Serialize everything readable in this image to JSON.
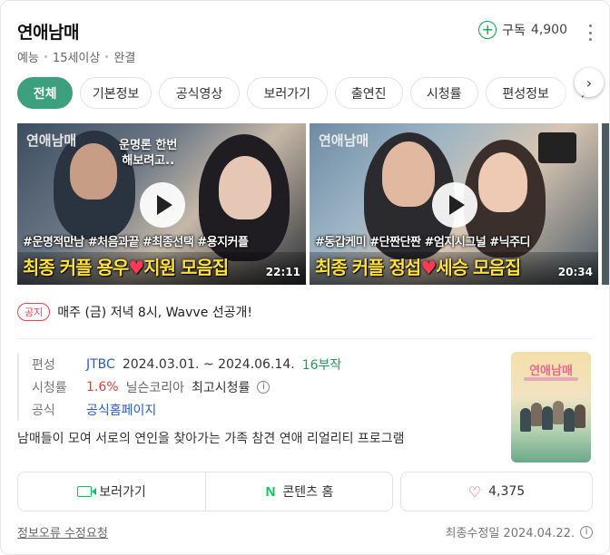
{
  "header": {
    "title": "연애남매",
    "meta": [
      "예능",
      "15세이상",
      "완결"
    ],
    "subscribe_label": "구독",
    "subscribe_count": "4,900",
    "subscribe_icon": "plus-icon",
    "more_icon": "kebab-icon"
  },
  "tabs": [
    {
      "label": "전체",
      "active": true
    },
    {
      "label": "기본정보",
      "active": false
    },
    {
      "label": "공식영상",
      "active": false
    },
    {
      "label": "보러가기",
      "active": false
    },
    {
      "label": "출연진",
      "active": false
    },
    {
      "label": "시청률",
      "active": false
    },
    {
      "label": "편성정보",
      "active": false
    }
  ],
  "clips": [
    {
      "logo": "연애남매",
      "bubble": "운명론 한번\n해보려고..",
      "hashtags": "#운명적만남 #처음과끝 #최종선택 #용지커플",
      "caption_a": "최종 커플 용우",
      "caption_b": "지원 모음집",
      "duration": "22:11"
    },
    {
      "logo": "연애남매",
      "bubble": "",
      "hashtags": "#동갑케미 #단짠단짠 #엄지시그널 #닉주디",
      "caption_a": "최종 커플 정섭",
      "caption_b": "세승 모음집",
      "duration": "20:34"
    }
  ],
  "notice": {
    "badge": "공지",
    "text": "매주 (금) 저녁 8시, Wavve 선공개!"
  },
  "info": {
    "schedule_key": "편성",
    "channel": "JTBC",
    "period": "2024.03.01. ~ 2024.06.14.",
    "episodes": "16부작",
    "rating_key": "시청률",
    "rating_value": "1.6%",
    "rating_source": "닐슨코리아",
    "rating_note": "최고시청률",
    "official_key": "공식",
    "official_link": "공식홈페이지",
    "description": "남매들이 모여 서로의 연인을 찾아가는 가족 참견 연애 리얼리티 프로그램"
  },
  "poster": {
    "title": "연애남매"
  },
  "buttons": {
    "watch": "보러가기",
    "contents_home": "콘텐츠 홈",
    "like_count": "4,375"
  },
  "footer": {
    "report": "정보오류 수정요청",
    "updated": "최종수정일 2024.04.22."
  },
  "colors": {
    "accent_green": "#3c9f7e",
    "naver_green": "#03c75a",
    "notice_red": "#f0424a",
    "link_blue": "#2a5acb",
    "rating_red": "#e83a3a"
  }
}
